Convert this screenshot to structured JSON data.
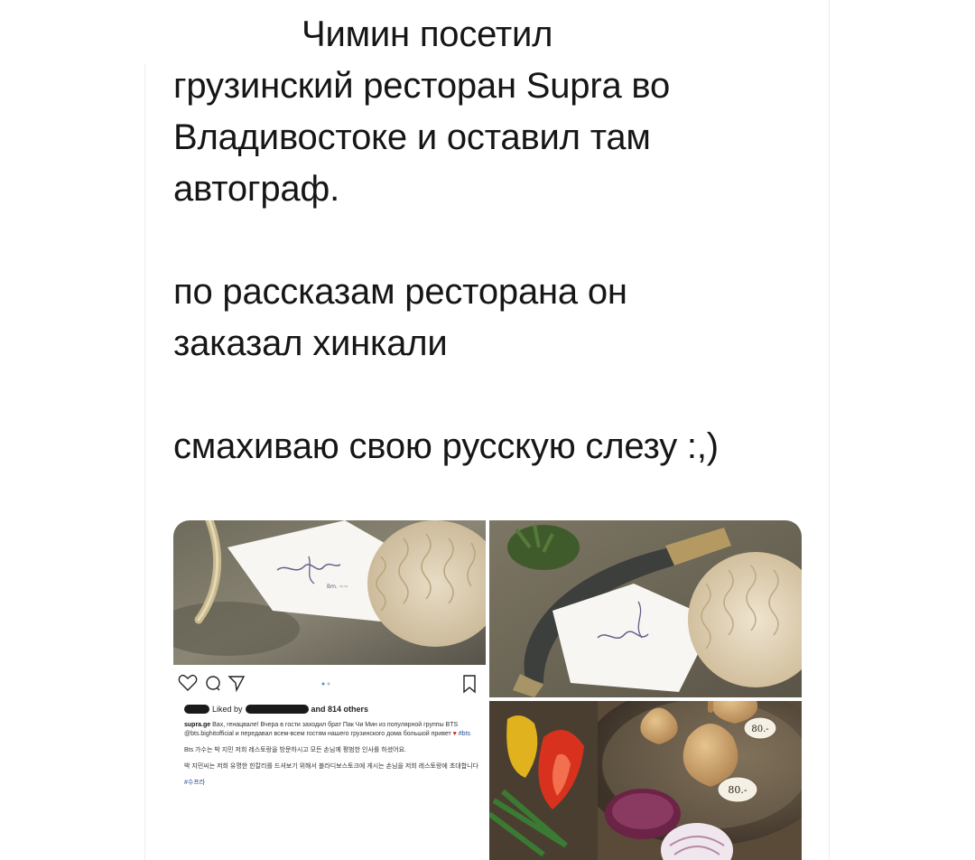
{
  "tweet": {
    "lines_block1": [
      "Чимин посетил",
      "грузинский ресторан Supra во",
      "Владивостоке и оставил там",
      "автограф."
    ],
    "lines_block2": [
      "по рассказам ресторана он",
      "заказал хинкали"
    ],
    "lines_block3": [
      "смахиваю свою русскую слезу :,)"
    ]
  },
  "media": {
    "instagram_post": {
      "liked_by_prefix": "Liked by",
      "liked_by_suffix": "and 814 others",
      "username": "supra.ge",
      "caption_ru": "Вах, генацвале! Вчера в гости заходил брат Пак Чи Мин из популярной группы BTS @bts.bighitofficial и передавал всем-всем гостям нашего грузинского дома большой привет",
      "caption_ru_tags": "#bts",
      "caption_ko_1": "Bts 가수는 박 지민 저희 레스토랑을 방문하시고 모든 손님께 평범한 인사를 하셨어요.",
      "caption_ko_2": "박 지민씨는 저희 유명한 힌칼리를 드셔보기 위해서 블라디보스토크에 게시는 손님을 저희 레스토랑에 초대합니다",
      "caption_ko_tag": "#수프라",
      "icons": [
        "heart-icon",
        "comment-icon",
        "share-icon",
        "bookmark-icon"
      ]
    },
    "price_tag_1": "80.-",
    "price_tag_2": "80.-"
  }
}
